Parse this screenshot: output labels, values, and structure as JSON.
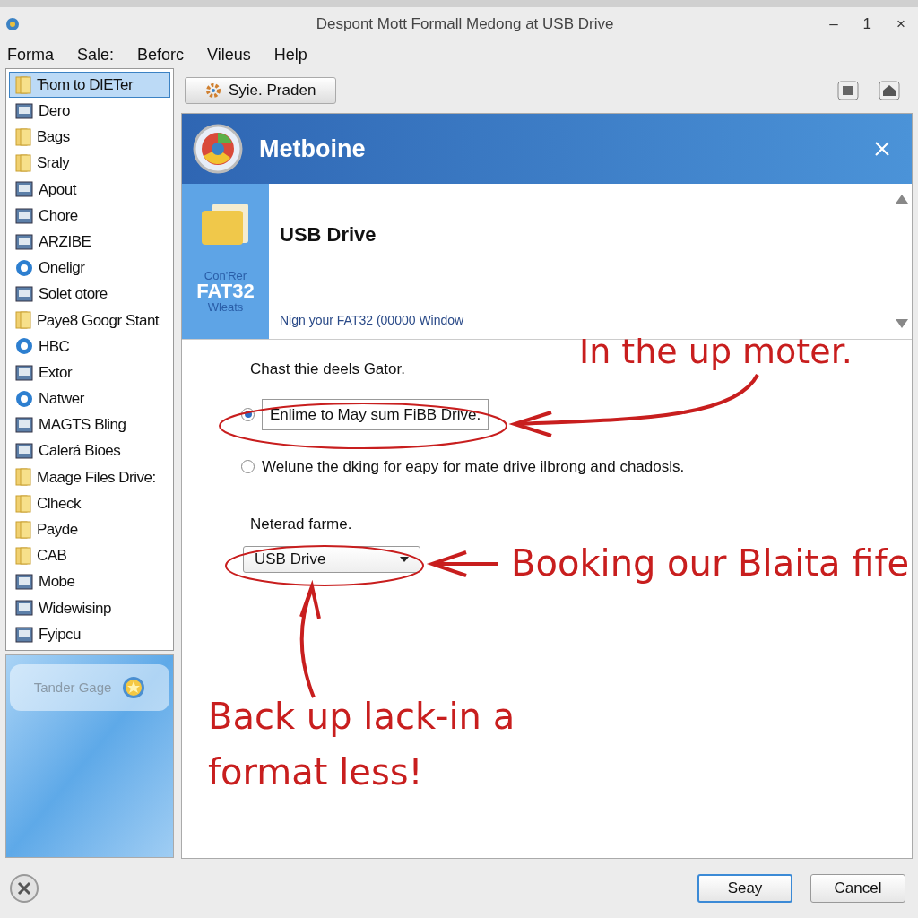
{
  "window": {
    "title": "Despont Mott Formall Medong at USB Drive",
    "controls": [
      "–",
      "1",
      "×"
    ]
  },
  "menu": [
    "Forma",
    "Sale:",
    "Beforc",
    "Vileus",
    "Help"
  ],
  "sidebar": {
    "items": [
      {
        "label": "Ћom to DIETer",
        "kind": "folder",
        "selected": true
      },
      {
        "label": "Dero",
        "kind": "app",
        "selected": false
      },
      {
        "label": "Bags",
        "kind": "folder",
        "selected": false
      },
      {
        "label": "Sraly",
        "kind": "folder",
        "selected": false
      },
      {
        "label": "Apout",
        "kind": "app",
        "selected": false
      },
      {
        "label": "Chore",
        "kind": "app",
        "selected": false
      },
      {
        "label": "ARZIBE",
        "kind": "app",
        "selected": false
      },
      {
        "label": "Oneligr",
        "kind": "globe",
        "selected": false
      },
      {
        "label": "Solet otore",
        "kind": "app",
        "selected": false
      },
      {
        "label": "Paye8 Googr Stant",
        "kind": "folder",
        "selected": false
      },
      {
        "label": "HBC",
        "kind": "globe",
        "selected": false
      },
      {
        "label": "Extor",
        "kind": "app",
        "selected": false
      },
      {
        "label": "Natwer",
        "kind": "globe",
        "selected": false
      },
      {
        "label": "MAGTS Bling",
        "kind": "app",
        "selected": false
      },
      {
        "label": "Calerá Bioes",
        "kind": "app",
        "selected": false
      },
      {
        "label": "Maage Files Drive:",
        "kind": "folder",
        "selected": false
      },
      {
        "label": "Clheck",
        "kind": "folder",
        "selected": false
      },
      {
        "label": "Payde",
        "kind": "folder",
        "selected": false
      },
      {
        "label": "CAB",
        "kind": "folder",
        "selected": false
      },
      {
        "label": "Mobe",
        "kind": "app",
        "selected": false
      },
      {
        "label": "Widewisinp",
        "kind": "app",
        "selected": false
      },
      {
        "label": "Fyipcu",
        "kind": "app",
        "selected": false
      }
    ],
    "promo": {
      "label": "Tander Gage"
    }
  },
  "toolbar": {
    "button": "Syie. Praden"
  },
  "panel": {
    "title": "Metboine",
    "badge": {
      "top": "Con'Rer",
      "main": "FAT32",
      "bottom": "Wleats"
    },
    "device": "USB Drive",
    "note": "Nign your FAT32 (00000 Window",
    "prompt": "Chast thie deels Gator.",
    "options": [
      {
        "label": "Enlime to May sum FiBB Drive.",
        "selected": true
      },
      {
        "label": "Welune the dking for eapy for mate drive ilbrong and chadosls.",
        "selected": false
      }
    ],
    "format_label": "Neterad farme.",
    "format_select": {
      "value": "USB Drive"
    }
  },
  "annotations": [
    {
      "text": "In the up moter."
    },
    {
      "text": "Booking our Blaita fife"
    },
    {
      "text": "Back up lack-in a format less!"
    }
  ],
  "buttons": [
    {
      "label": "Seay",
      "default": true
    },
    {
      "label": "Cancel",
      "default": false
    }
  ]
}
